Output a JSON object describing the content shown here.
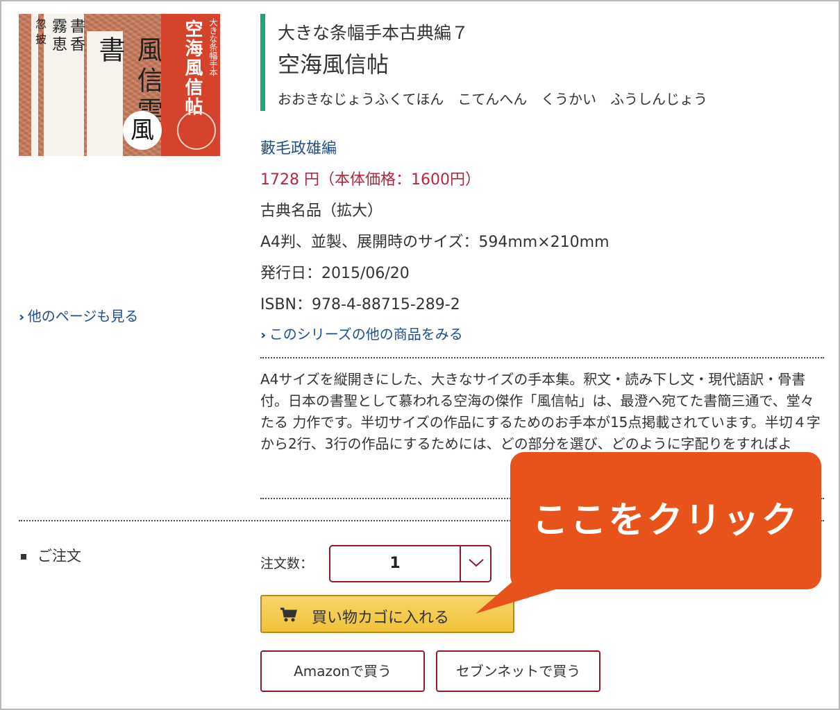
{
  "cover": {
    "brush_lines": [
      "忽披",
      "霧恵",
      "書香",
      "風信雲書"
    ],
    "red_title": "空海風信帖",
    "red_sub": "大きな条幅手本",
    "circle_char": "風"
  },
  "more_pages_link": "他のページも見る",
  "product": {
    "series_title": "大きな条幅手本古典編７",
    "title": "空海風信帖",
    "reading": "おおきなじょうふくてほん　こてんへん　くうかい　ふうしんじょう",
    "author": "藪毛政雄編",
    "price": "1728 円（本体価格：1600円）",
    "category": "古典名品（拡大）",
    "format": "A4判、並製、展開時のサイズ：594mm×210mm",
    "date": "発行日：2015/06/20",
    "isbn": "ISBN：978-4-88715-289-2",
    "series_link": "このシリーズの他の商品をみる",
    "description": "A4サイズを縦開きにした、大きなサイズの手本集。釈文・読み下し文・現代語訳・骨書付。日本の書聖として慕われる空海の傑作「風信帖」は、最澄へ宛てた書簡三通で、堂々たる 力作です。半切サイズの作品にするためのお手本が15点掲載されています。半切４字から2行、3行の作品にするためには、どの部分を選び、どのように字配りをすればよ"
  },
  "order": {
    "section_label": "ご注文",
    "qty_label": "注文数：",
    "qty_value": "1",
    "cart_button": "買い物カゴに入れる",
    "amazon_button": "Amazonで買う",
    "seven_button": "セブンネットで買う"
  },
  "callout": {
    "text": "ここをクリック"
  },
  "colors": {
    "accent_green": "#1fa57a",
    "price_red": "#b3263d",
    "link_blue": "#1f4f8f",
    "callout_orange": "#e8531c",
    "cart_yellow": "#f1c23a"
  }
}
